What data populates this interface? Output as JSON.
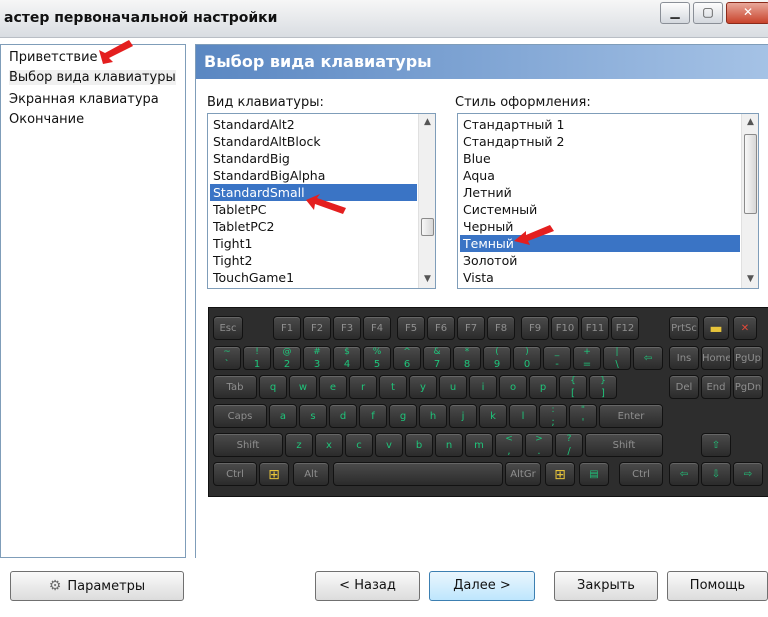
{
  "window": {
    "title": "астер первоначальной настройки",
    "min_icon": "minimize-icon",
    "max_icon": "maximize-icon",
    "close_icon": "close-icon"
  },
  "nav": {
    "items": [
      {
        "label": "Приветствие"
      },
      {
        "label": "Выбор вида клавиатуры"
      },
      {
        "label": "Экранная клавиатура"
      },
      {
        "label": "Окончание"
      }
    ],
    "active_index": 1
  },
  "header": {
    "title": "Выбор вида клавиатуры"
  },
  "keyboard_type": {
    "label": "Вид клавиатуры:",
    "items": [
      "StandardAlt2",
      "StandardAltBlock",
      "StandardBig",
      "StandardBigAlpha",
      "StandardSmall",
      "TabletPC",
      "TabletPC2",
      "Tight1",
      "Tight2",
      "TouchGame1"
    ],
    "selected": "StandardSmall"
  },
  "style": {
    "label": "Стиль оформления:",
    "items": [
      "Стандартный 1",
      "Стандартный 2",
      "Blue",
      "Aqua",
      "Летний",
      "Системный",
      "Черный",
      "Темный",
      "Золотой",
      "Vista"
    ],
    "selected": "Темный"
  },
  "keyboard": {
    "row1": [
      "Esc",
      "F1",
      "F2",
      "F3",
      "F4",
      "F5",
      "F6",
      "F7",
      "F8",
      "F9",
      "F10",
      "F11",
      "F12",
      "PrtSc"
    ],
    "row2_top": [
      "~",
      "!",
      "@",
      "#",
      "$",
      "%",
      "^",
      "&",
      "*",
      "(",
      ")",
      "_",
      "+",
      "|"
    ],
    "row2_bottom": [
      "`",
      "1",
      "2",
      "3",
      "4",
      "5",
      "6",
      "7",
      "8",
      "9",
      "0",
      "-",
      "=",
      "\\"
    ],
    "row2_extra": [
      "Ins",
      "Home",
      "PgUp"
    ],
    "row3": [
      "Tab",
      "q",
      "w",
      "e",
      "r",
      "t",
      "y",
      "u",
      "i",
      "o",
      "p",
      "[",
      "]"
    ],
    "row3_top": [
      "{",
      "}"
    ],
    "row3_extra": [
      "Del",
      "End",
      "PgDn"
    ],
    "row4": [
      "Caps",
      "a",
      "s",
      "d",
      "f",
      "g",
      "h",
      "j",
      "k",
      "l",
      ";",
      "'",
      "Enter"
    ],
    "row4_top": [
      ":",
      "\""
    ],
    "row5": [
      "Shift",
      "z",
      "x",
      "c",
      "v",
      "b",
      "n",
      "m",
      ",",
      ".",
      "/",
      "Shift"
    ],
    "row5_top": [
      "<",
      ">",
      "?"
    ],
    "row6": [
      "Ctrl",
      "Alt",
      "AltGr",
      "Ctrl"
    ],
    "backspace_icon": "backspace-arrow-icon",
    "up_icon": "arrow-up-icon",
    "left_icon": "arrow-left-icon",
    "down_icon": "arrow-down-icon",
    "right_icon": "arrow-right-icon",
    "win_icon": "windows-flag-icon",
    "menu_icon": "context-menu-icon"
  },
  "buttons": {
    "params": "Параметры",
    "back": "< Назад",
    "next": "Далее >",
    "close": "Закрыть",
    "help": "Помощь"
  },
  "colors": {
    "selection": "#3a74c5",
    "key_text": "#1fc47a",
    "header": "#5a87c2"
  }
}
